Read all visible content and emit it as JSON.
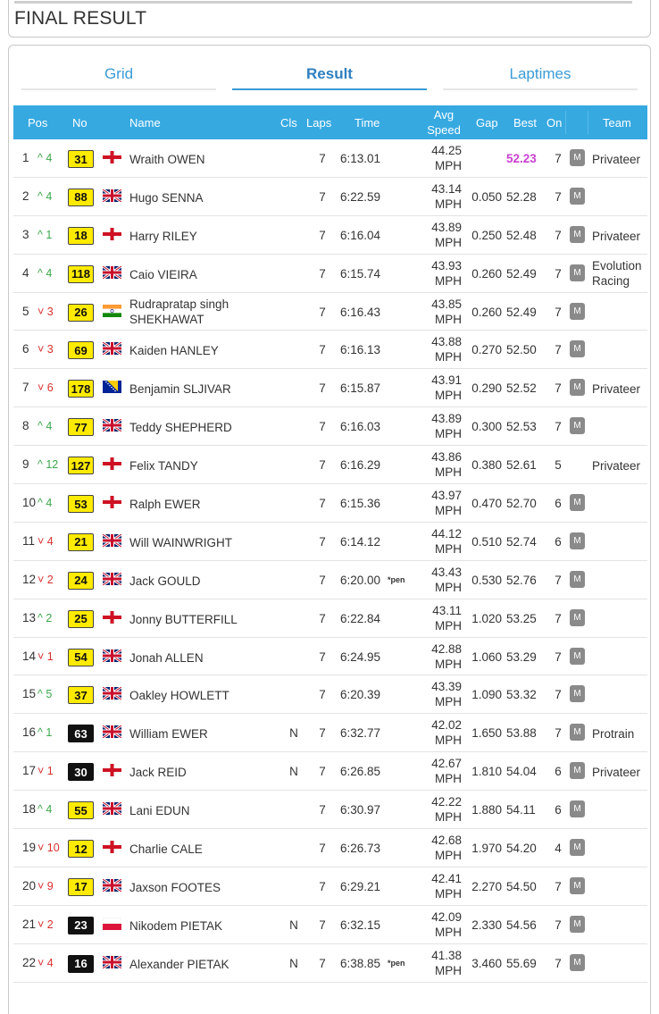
{
  "header": {
    "title": "FINAL RESULT"
  },
  "tabs": [
    {
      "label": "Grid"
    },
    {
      "label": "Result"
    },
    {
      "label": "Laptimes"
    }
  ],
  "columns": {
    "pos": "Pos",
    "no": "No",
    "name": "Name",
    "cls": "Cls",
    "laps": "Laps",
    "time": "Time",
    "avg": "Avg",
    "speed": "Speed",
    "gap": "Gap",
    "best": "Best",
    "on": "On",
    "team": "Team"
  },
  "colors": {
    "header_bg": "#36a9e1",
    "number_yellow": "#ffeb00",
    "number_black": "#111111",
    "up": "#3aa84a",
    "down": "#d9302f",
    "fastest": "#c940d0"
  },
  "rows": [
    {
      "pos": "1",
      "dir": "up",
      "chg": "4",
      "no": "31",
      "plate": "yellow",
      "flag": "england",
      "name": "Wraith OWEN",
      "cls": "",
      "laps": "7",
      "time": "6:13.01",
      "pen": "",
      "speed": "44.25",
      "unit": "MPH",
      "gap": "",
      "best": "52.23",
      "fastest": true,
      "on": "7",
      "m": "M",
      "team": "Privateer"
    },
    {
      "pos": "2",
      "dir": "up",
      "chg": "4",
      "no": "88",
      "plate": "yellow",
      "flag": "uk",
      "name": "Hugo SENNA",
      "cls": "",
      "laps": "7",
      "time": "6:22.59",
      "pen": "",
      "speed": "43.14",
      "unit": "MPH",
      "gap": "0.050",
      "best": "52.28",
      "on": "7",
      "m": "M",
      "team": ""
    },
    {
      "pos": "3",
      "dir": "up",
      "chg": "1",
      "no": "18",
      "plate": "yellow",
      "flag": "england",
      "name": "Harry RILEY",
      "cls": "",
      "laps": "7",
      "time": "6:16.04",
      "pen": "",
      "speed": "43.89",
      "unit": "MPH",
      "gap": "0.250",
      "best": "52.48",
      "on": "7",
      "m": "M",
      "team": "Privateer"
    },
    {
      "pos": "4",
      "dir": "up",
      "chg": "4",
      "no": "118",
      "plate": "yellow",
      "flag": "uk",
      "name": "Caio VIEIRA",
      "cls": "",
      "laps": "7",
      "time": "6:15.74",
      "pen": "",
      "speed": "43.93",
      "unit": "MPH",
      "gap": "0.260",
      "best": "52.49",
      "on": "7",
      "m": "M",
      "team": "Evolution Racing"
    },
    {
      "pos": "5",
      "dir": "down",
      "chg": "3",
      "no": "26",
      "plate": "yellow",
      "flag": "india",
      "name": "Rudrapratap singh SHEKHAWAT",
      "cls": "",
      "laps": "7",
      "time": "6:16.43",
      "pen": "",
      "speed": "43.85",
      "unit": "MPH",
      "gap": "0.260",
      "best": "52.49",
      "on": "7",
      "m": "M",
      "team": ""
    },
    {
      "pos": "6",
      "dir": "down",
      "chg": "3",
      "no": "69",
      "plate": "yellow",
      "flag": "uk",
      "name": "Kaiden HANLEY",
      "cls": "",
      "laps": "7",
      "time": "6:16.13",
      "pen": "",
      "speed": "43.88",
      "unit": "MPH",
      "gap": "0.270",
      "best": "52.50",
      "on": "7",
      "m": "M",
      "team": ""
    },
    {
      "pos": "7",
      "dir": "down",
      "chg": "6",
      "no": "178",
      "plate": "yellow",
      "flag": "bosnia",
      "name": "Benjamin SLJIVAR",
      "cls": "",
      "laps": "7",
      "time": "6:15.87",
      "pen": "",
      "speed": "43.91",
      "unit": "MPH",
      "gap": "0.290",
      "best": "52.52",
      "on": "7",
      "m": "M",
      "team": "Privateer"
    },
    {
      "pos": "8",
      "dir": "up",
      "chg": "4",
      "no": "77",
      "plate": "yellow",
      "flag": "uk",
      "name": "Teddy SHEPHERD",
      "cls": "",
      "laps": "7",
      "time": "6:16.03",
      "pen": "",
      "speed": "43.89",
      "unit": "MPH",
      "gap": "0.300",
      "best": "52.53",
      "on": "7",
      "m": "M",
      "team": ""
    },
    {
      "pos": "9",
      "dir": "up",
      "chg": "12",
      "no": "127",
      "plate": "yellow",
      "flag": "england",
      "name": "Felix TANDY",
      "cls": "",
      "laps": "7",
      "time": "6:16.29",
      "pen": "",
      "speed": "43.86",
      "unit": "MPH",
      "gap": "0.380",
      "best": "52.61",
      "on": "5",
      "m": "",
      "team": "Privateer"
    },
    {
      "pos": "10",
      "dir": "up",
      "chg": "4",
      "no": "53",
      "plate": "yellow",
      "flag": "england",
      "name": "Ralph EWER",
      "cls": "",
      "laps": "7",
      "time": "6:15.36",
      "pen": "",
      "speed": "43.97",
      "unit": "MPH",
      "gap": "0.470",
      "best": "52.70",
      "on": "6",
      "m": "M",
      "team": ""
    },
    {
      "pos": "11",
      "dir": "down",
      "chg": "4",
      "no": "21",
      "plate": "yellow",
      "flag": "uk",
      "name": "Will WAINWRIGHT",
      "cls": "",
      "laps": "7",
      "time": "6:14.12",
      "pen": "",
      "speed": "44.12",
      "unit": "MPH",
      "gap": "0.510",
      "best": "52.74",
      "on": "6",
      "m": "M",
      "team": ""
    },
    {
      "pos": "12",
      "dir": "down",
      "chg": "2",
      "no": "24",
      "plate": "yellow",
      "flag": "uk",
      "name": "Jack GOULD",
      "cls": "",
      "laps": "7",
      "time": "6:20.00",
      "pen": "*pen",
      "speed": "43.43",
      "unit": "MPH",
      "gap": "0.530",
      "best": "52.76",
      "on": "7",
      "m": "M",
      "team": ""
    },
    {
      "pos": "13",
      "dir": "up",
      "chg": "2",
      "no": "25",
      "plate": "yellow",
      "flag": "england",
      "name": "Jonny BUTTERFILL",
      "cls": "",
      "laps": "7",
      "time": "6:22.84",
      "pen": "",
      "speed": "43.11",
      "unit": "MPH",
      "gap": "1.020",
      "best": "53.25",
      "on": "7",
      "m": "M",
      "team": ""
    },
    {
      "pos": "14",
      "dir": "down",
      "chg": "1",
      "no": "54",
      "plate": "yellow",
      "flag": "uk",
      "name": "Jonah ALLEN",
      "cls": "",
      "laps": "7",
      "time": "6:24.95",
      "pen": "",
      "speed": "42.88",
      "unit": "MPH",
      "gap": "1.060",
      "best": "53.29",
      "on": "7",
      "m": "M",
      "team": ""
    },
    {
      "pos": "15",
      "dir": "up",
      "chg": "5",
      "no": "37",
      "plate": "yellow",
      "flag": "uk",
      "name": "Oakley HOWLETT",
      "cls": "",
      "laps": "7",
      "time": "6:20.39",
      "pen": "",
      "speed": "43.39",
      "unit": "MPH",
      "gap": "1.090",
      "best": "53.32",
      "on": "7",
      "m": "M",
      "team": ""
    },
    {
      "pos": "16",
      "dir": "up",
      "chg": "1",
      "no": "63",
      "plate": "black",
      "flag": "uk",
      "name": "William EWER",
      "cls": "N",
      "laps": "7",
      "time": "6:32.77",
      "pen": "",
      "speed": "42.02",
      "unit": "MPH",
      "gap": "1.650",
      "best": "53.88",
      "on": "7",
      "m": "M",
      "team": "Protrain"
    },
    {
      "pos": "17",
      "dir": "down",
      "chg": "1",
      "no": "30",
      "plate": "black",
      "flag": "england",
      "name": "Jack REID",
      "cls": "N",
      "laps": "7",
      "time": "6:26.85",
      "pen": "",
      "speed": "42.67",
      "unit": "MPH",
      "gap": "1.810",
      "best": "54.04",
      "on": "6",
      "m": "M",
      "team": "Privateer"
    },
    {
      "pos": "18",
      "dir": "up",
      "chg": "4",
      "no": "55",
      "plate": "yellow",
      "flag": "uk",
      "name": "Lani EDUN",
      "cls": "",
      "laps": "7",
      "time": "6:30.97",
      "pen": "",
      "speed": "42.22",
      "unit": "MPH",
      "gap": "1.880",
      "best": "54.11",
      "on": "6",
      "m": "M",
      "team": ""
    },
    {
      "pos": "19",
      "dir": "down",
      "chg": "10",
      "no": "12",
      "plate": "yellow",
      "flag": "england",
      "name": "Charlie CALE",
      "cls": "",
      "laps": "7",
      "time": "6:26.73",
      "pen": "",
      "speed": "42.68",
      "unit": "MPH",
      "gap": "1.970",
      "best": "54.20",
      "on": "4",
      "m": "M",
      "team": ""
    },
    {
      "pos": "20",
      "dir": "down",
      "chg": "9",
      "no": "17",
      "plate": "yellow",
      "flag": "uk",
      "name": "Jaxson FOOTES",
      "cls": "",
      "laps": "7",
      "time": "6:29.21",
      "pen": "",
      "speed": "42.41",
      "unit": "MPH",
      "gap": "2.270",
      "best": "54.50",
      "on": "7",
      "m": "M",
      "team": ""
    },
    {
      "pos": "21",
      "dir": "down",
      "chg": "2",
      "no": "23",
      "plate": "black",
      "flag": "poland",
      "name": "Nikodem PIETAK",
      "cls": "N",
      "laps": "7",
      "time": "6:32.15",
      "pen": "",
      "speed": "42.09",
      "unit": "MPH",
      "gap": "2.330",
      "best": "54.56",
      "on": "7",
      "m": "M",
      "team": ""
    },
    {
      "pos": "22",
      "dir": "down",
      "chg": "4",
      "no": "16",
      "plate": "black",
      "flag": "uk",
      "name": "Alexander PIETAK",
      "cls": "N",
      "laps": "7",
      "time": "6:38.85",
      "pen": "*pen",
      "speed": "41.38",
      "unit": "MPH",
      "gap": "3.460",
      "best": "55.69",
      "on": "7",
      "m": "M",
      "team": ""
    }
  ]
}
